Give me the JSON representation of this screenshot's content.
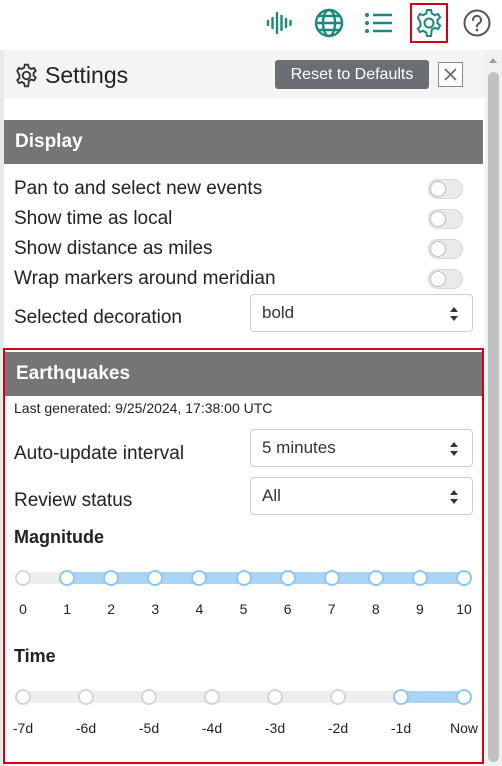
{
  "toolbar": {
    "icons": [
      "waveform-icon",
      "globe-icon",
      "list-icon",
      "gear-icon",
      "help-icon"
    ],
    "active_icon": "gear-icon",
    "accent_color": "#1a8a7e",
    "active_border_color": "#d0021b"
  },
  "header": {
    "title": "Settings",
    "reset_label": "Reset to Defaults"
  },
  "display": {
    "title": "Display",
    "toggles": [
      {
        "label": "Pan to and select new events",
        "on": false
      },
      {
        "label": "Show time as local",
        "on": false
      },
      {
        "label": "Show distance as miles",
        "on": false
      },
      {
        "label": "Wrap markers around meridian",
        "on": false
      }
    ],
    "decoration_label": "Selected decoration",
    "decoration_value": "bold"
  },
  "earthquakes": {
    "title": "Earthquakes",
    "last_generated": "Last generated: 9/25/2024, 17:38:00 UTC",
    "auto_update_label": "Auto-update interval",
    "auto_update_value": "5 minutes",
    "review_label": "Review status",
    "review_value": "All",
    "magnitude": {
      "title": "Magnitude",
      "ticks": [
        "0",
        "1",
        "2",
        "3",
        "4",
        "5",
        "6",
        "7",
        "8",
        "9",
        "10"
      ],
      "selected_range": [
        1,
        10
      ]
    },
    "time": {
      "title": "Time",
      "ticks": [
        "-7d",
        "-6d",
        "-5d",
        "-4d",
        "-3d",
        "-2d",
        "-1d",
        "Now"
      ],
      "selected_range": [
        6,
        7
      ]
    }
  },
  "colors": {
    "section_header_bg": "#757575",
    "slider_fill": "#a9d4f5",
    "highlight_frame": "#d0021b"
  }
}
